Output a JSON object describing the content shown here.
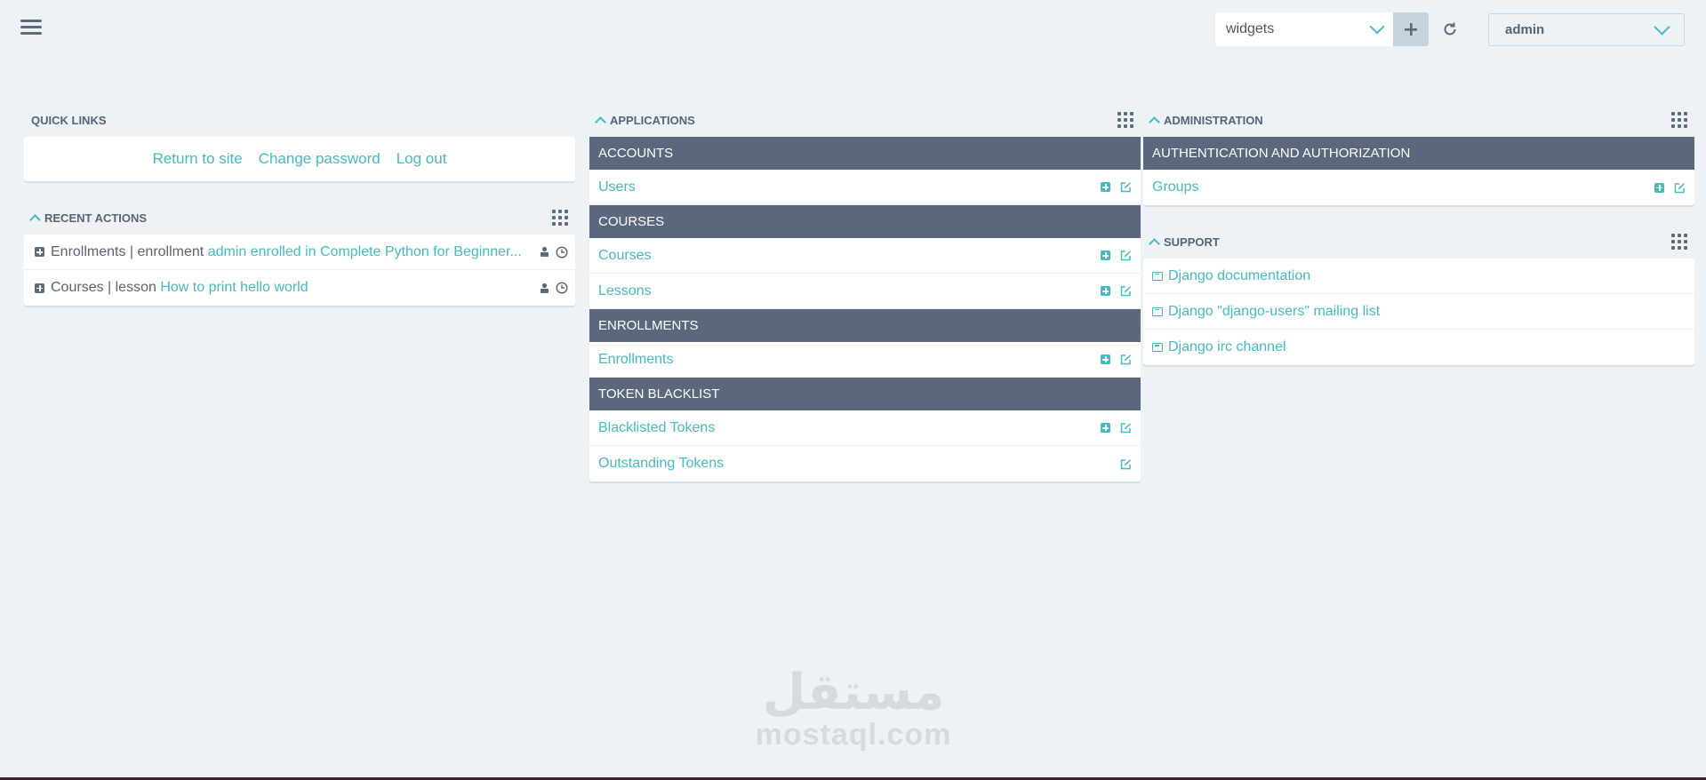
{
  "topbar": {
    "widget_select_value": "widgets",
    "user_select_value": "admin"
  },
  "quick_links": {
    "title": "QUICK LINKS",
    "links": [
      "Return to site",
      "Change password",
      "Log out"
    ]
  },
  "recent_actions": {
    "title": "RECENT ACTIONS",
    "items": [
      {
        "prefix": "Enrollments | enrollment",
        "link": "admin enrolled in Complete Python for Beginner..."
      },
      {
        "prefix": "Courses | lesson",
        "link": "How to print hello world"
      }
    ]
  },
  "applications": {
    "title": "APPLICATIONS",
    "sections": [
      {
        "name": "ACCOUNTS",
        "items": [
          {
            "label": "Users",
            "add": true
          }
        ]
      },
      {
        "name": "COURSES",
        "items": [
          {
            "label": "Courses",
            "add": true
          },
          {
            "label": "Lessons",
            "add": true
          }
        ]
      },
      {
        "name": "ENROLLMENTS",
        "items": [
          {
            "label": "Enrollments",
            "add": true
          }
        ]
      },
      {
        "name": "TOKEN BLACKLIST",
        "items": [
          {
            "label": "Blacklisted Tokens",
            "add": true
          },
          {
            "label": "Outstanding Tokens",
            "add": false
          }
        ]
      }
    ]
  },
  "administration": {
    "title": "ADMINISTRATION",
    "sections": [
      {
        "name": "AUTHENTICATION AND AUTHORIZATION",
        "items": [
          {
            "label": "Groups",
            "add": true
          }
        ]
      }
    ]
  },
  "support": {
    "title": "SUPPORT",
    "links": [
      "Django documentation",
      "Django \"django-users\" mailing list",
      "Django irc channel"
    ]
  },
  "watermark": {
    "arabic": "مستقل",
    "latin": "mostaql.com"
  },
  "colors": {
    "accent": "#47bac1",
    "section_header": "#5b677c",
    "background": "#ecf2f6"
  }
}
